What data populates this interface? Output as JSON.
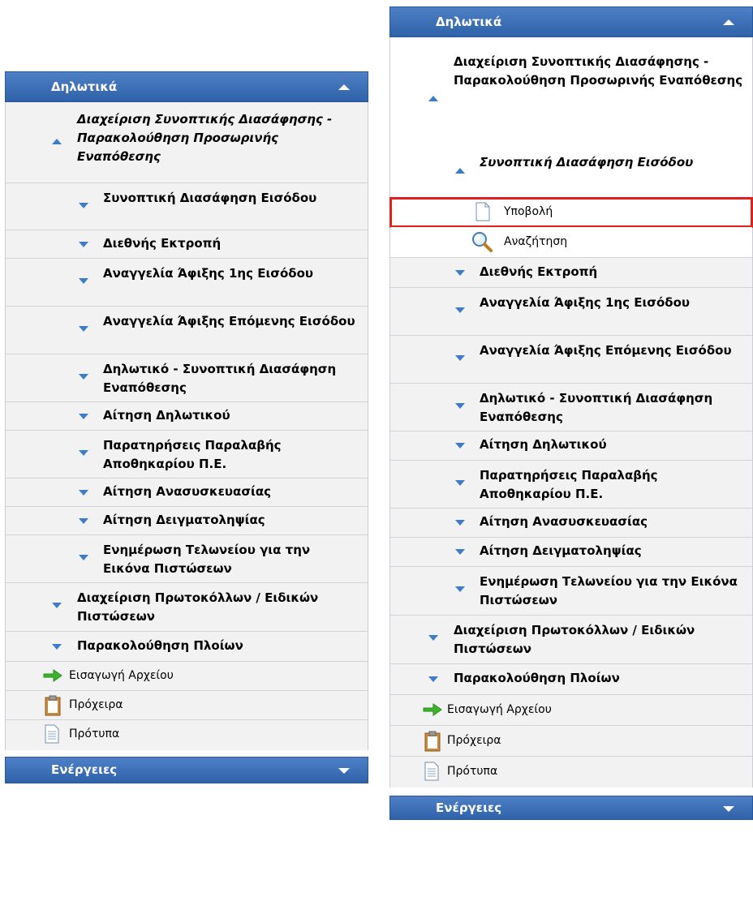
{
  "left": {
    "header": "Δηλωτικά",
    "group": "Διαχείριση Συνοπτικής Διασάφησης - Παρακολούθηση Προσωρινής Εναπόθεσης",
    "items": [
      "Συνοπτική Διασάφηση Εισόδου",
      "Διεθνής Εκτροπή",
      "Αναγγελία Άφιξης 1ης Εισόδου",
      "Αναγγελία Άφιξης Επόμενης Εισόδου",
      "Δηλωτικό - Συνοπτική Διασάφηση Εναπόθεσης",
      "Αίτηση Δηλωτικού",
      "Παρατηρήσεις Παραλαβής Αποθηκαρίου Π.Ε.",
      "Αίτηση Ανασυσκευασίας",
      "Αίτηση Δειγματοληψίας",
      "Ενημέρωση Τελωνείου για την Εικόνα Πιστώσεων"
    ],
    "group2": "Διαχείριση Πρωτοκόλλων / Ειδικών Πιστώσεων",
    "group3": "Παρακολούθηση Πλοίων",
    "import_file": "Εισαγωγή Αρχείου",
    "drafts": "Πρόχειρα",
    "templates": "Πρότυπα",
    "footer": "Ενέργειες"
  },
  "right": {
    "header": "Δηλωτικά",
    "group": "Διαχείριση Συνοπτικής Διασάφησης - Παρακολούθηση Προσωρινής Εναπόθεσης",
    "sub_open": "Συνοπτική Διασάφηση Εισόδου",
    "submit": "Υποβολή",
    "search": "Αναζήτηση",
    "items": [
      "Διεθνής Εκτροπή",
      "Αναγγελία Άφιξης 1ης Εισόδου",
      "Αναγγελία Άφιξης Επόμενης Εισόδου",
      "Δηλωτικό - Συνοπτική Διασάφηση Εναπόθεσης",
      "Αίτηση Δηλωτικού",
      "Παρατηρήσεις Παραλαβής Αποθηκαρίου Π.Ε.",
      "Αίτηση Ανασυσκευασίας",
      "Αίτηση Δειγματοληψίας",
      "Ενημέρωση Τελωνείου για την Εικόνα Πιστώσεων"
    ],
    "group2": "Διαχείριση Πρωτοκόλλων / Ειδικών Πιστώσεων",
    "group3": "Παρακολούθηση Πλοίων",
    "import_file": "Εισαγωγή Αρχείου",
    "drafts": "Πρόχειρα",
    "templates": "Πρότυπα",
    "footer": "Ενέργειες"
  },
  "icons": {
    "expanded": "triangle-up-icon",
    "collapsed": "triangle-down-icon",
    "import": "green-arrow-icon",
    "drafts": "clipboard-icon",
    "templates": "document-icon",
    "submit": "blank-page-icon",
    "search": "magnifier-icon"
  },
  "colors": {
    "header": "#3a6db5",
    "triangle": "#3d7cc9",
    "highlight": "#e0201e"
  }
}
